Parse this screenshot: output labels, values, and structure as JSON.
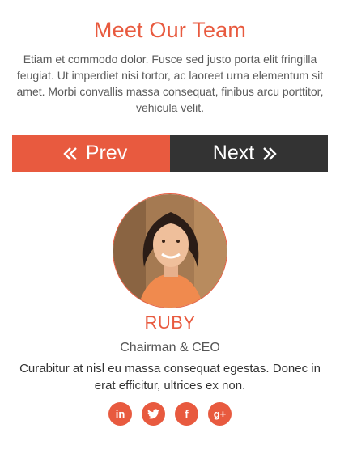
{
  "section": {
    "title": "Meet Our Team",
    "intro": "Etiam et commodo dolor. Fusce sed justo porta elit fringilla feugiat. Ut imperdiet nisi tortor, ac laoreet urna elementum sit amet. Morbi convallis massa consequat, finibus arcu porttitor, vehicula velit."
  },
  "navigation": {
    "prev_label": "Prev",
    "next_label": "Next"
  },
  "member": {
    "name": "RUBY",
    "role": "Chairman & CEO",
    "bio": "Curabitur at nisl eu massa consequat egestas. Donec in erat efficitur, ultrices ex non."
  },
  "social": [
    {
      "icon": "linkedin-icon",
      "glyph": "in"
    },
    {
      "icon": "twitter-icon",
      "glyph": "t"
    },
    {
      "icon": "facebook-icon",
      "glyph": "f"
    },
    {
      "icon": "google-plus-icon",
      "glyph": "g+"
    }
  ],
  "colors": {
    "accent": "#e85a3f",
    "dark": "#333333"
  }
}
